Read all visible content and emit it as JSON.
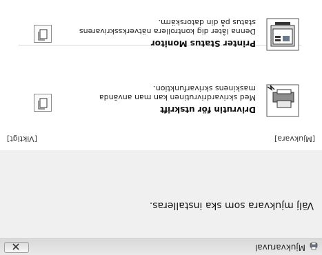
{
  "window": {
    "title": "Mjukvaruval",
    "close_label": "×"
  },
  "heading": "Välj mjukvara som ska installeras.",
  "sections": {
    "left_tag": "[Mjukvara]",
    "right_tag": "[Viktigt]"
  },
  "options": [
    {
      "title": "Drivrutin för utskrift",
      "description": "Med skrivardrivrutinen kan man använda maskinens skrivarfunktion."
    },
    {
      "title": "Printer Status Monitor",
      "description": "Denna låter dig kontrollera nätverksskrivarens status på din datorskärm."
    }
  ],
  "icons": {
    "app": "printer-app-icon",
    "close": "close-icon",
    "driver": "printer-driver-icon",
    "monitor": "status-monitor-icon",
    "document": "document-icon"
  }
}
